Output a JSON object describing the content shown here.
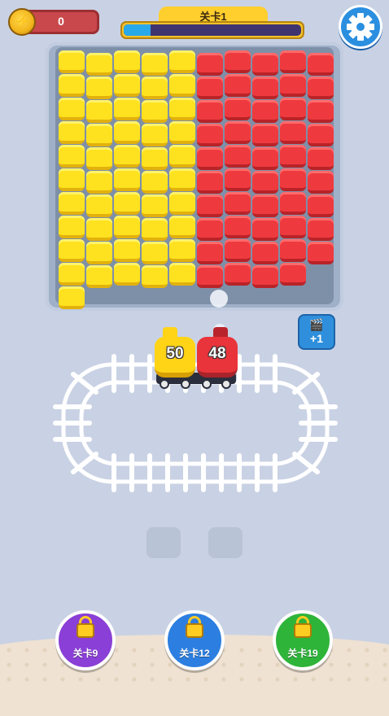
{
  "coins": {
    "value": "0",
    "icon": "coin-icon"
  },
  "level": {
    "label": "关卡1",
    "progress": 0.15
  },
  "settings": {
    "icon": "gear-icon"
  },
  "bin": {
    "yellow_columns": 5,
    "red_columns": 5,
    "colors": {
      "yellow": "#ffe21f",
      "red": "#ee3a3f"
    }
  },
  "plus_one": {
    "icon": "clapperboard-icon",
    "label": "+1"
  },
  "trains": [
    {
      "color": "yellow",
      "count": "50"
    },
    {
      "color": "red",
      "count": "48"
    }
  ],
  "level_buttons": [
    {
      "label": "关卡9",
      "color": "#8a3fd6"
    },
    {
      "label": "关卡12",
      "color": "#2c7fe0"
    },
    {
      "label": "关卡19",
      "color": "#2fb43a"
    }
  ]
}
